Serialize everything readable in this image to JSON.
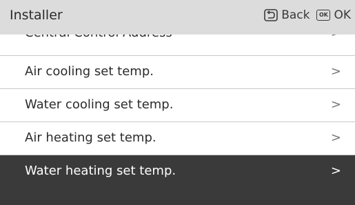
{
  "header": {
    "title": "Installer",
    "back_label": "Back",
    "ok_icon_text": "OK",
    "ok_label": "OK"
  },
  "menu": {
    "items": [
      {
        "label": "Central Control Address",
        "chevron": ">",
        "selected": false
      },
      {
        "label": "Air cooling set temp.",
        "chevron": ">",
        "selected": false
      },
      {
        "label": "Water cooling set temp.",
        "chevron": ">",
        "selected": false
      },
      {
        "label": "Air heating set temp.",
        "chevron": ">",
        "selected": false
      },
      {
        "label": "Water heating set temp.",
        "chevron": ">",
        "selected": true
      }
    ]
  },
  "colors": {
    "header_bg": "#dcdcdc",
    "selected_bg": "#3a3a3a",
    "divider": "#c8c8c8",
    "text": "#2b2b2b"
  }
}
